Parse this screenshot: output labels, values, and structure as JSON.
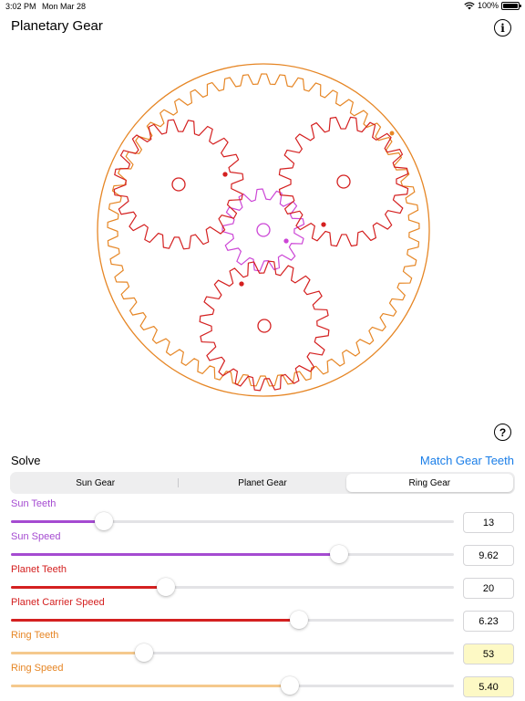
{
  "status_bar": {
    "time": "3:02 PM",
    "date": "Mon Mar 28",
    "battery": "100%",
    "battery_level": 1.0
  },
  "header": {
    "title": "Planetary Gear",
    "info_icon": "info-icon"
  },
  "help_icon": "question-icon",
  "solve": {
    "label": "Solve",
    "match_label": "Match Gear Teeth"
  },
  "tabs": [
    {
      "label": "Sun Gear",
      "selected": false
    },
    {
      "label": "Planet Gear",
      "selected": false
    },
    {
      "label": "Ring Gear",
      "selected": true
    }
  ],
  "colors": {
    "sun": "#cc46d6",
    "sun_slider": "#a54bd1",
    "planet": "#d42020",
    "ring": "#e68625",
    "ring_slider": "#f5c98d",
    "link": "#1a7ee8",
    "highlight": "#fdf9c5"
  },
  "parameters": [
    {
      "label": "Sun Teeth",
      "value": "13",
      "slider_fraction": 0.21,
      "highlighted": false
    },
    {
      "label": "Sun Speed",
      "value": "9.62",
      "slider_fraction": 0.74,
      "highlighted": false
    },
    {
      "label": "Planet Teeth",
      "value": "20",
      "slider_fraction": 0.35,
      "highlighted": false
    },
    {
      "label": "Planet Carrier Speed",
      "value": "6.23",
      "slider_fraction": 0.65,
      "highlighted": false
    },
    {
      "label": "Ring Teeth",
      "value": "53",
      "slider_fraction": 0.3,
      "highlighted": true
    },
    {
      "label": "Ring Speed",
      "value": "5.40",
      "slider_fraction": 0.63,
      "highlighted": true
    }
  ],
  "gears": {
    "sun_teeth": 13,
    "planet_teeth": 20,
    "ring_teeth": 53,
    "planet_count": 3
  }
}
